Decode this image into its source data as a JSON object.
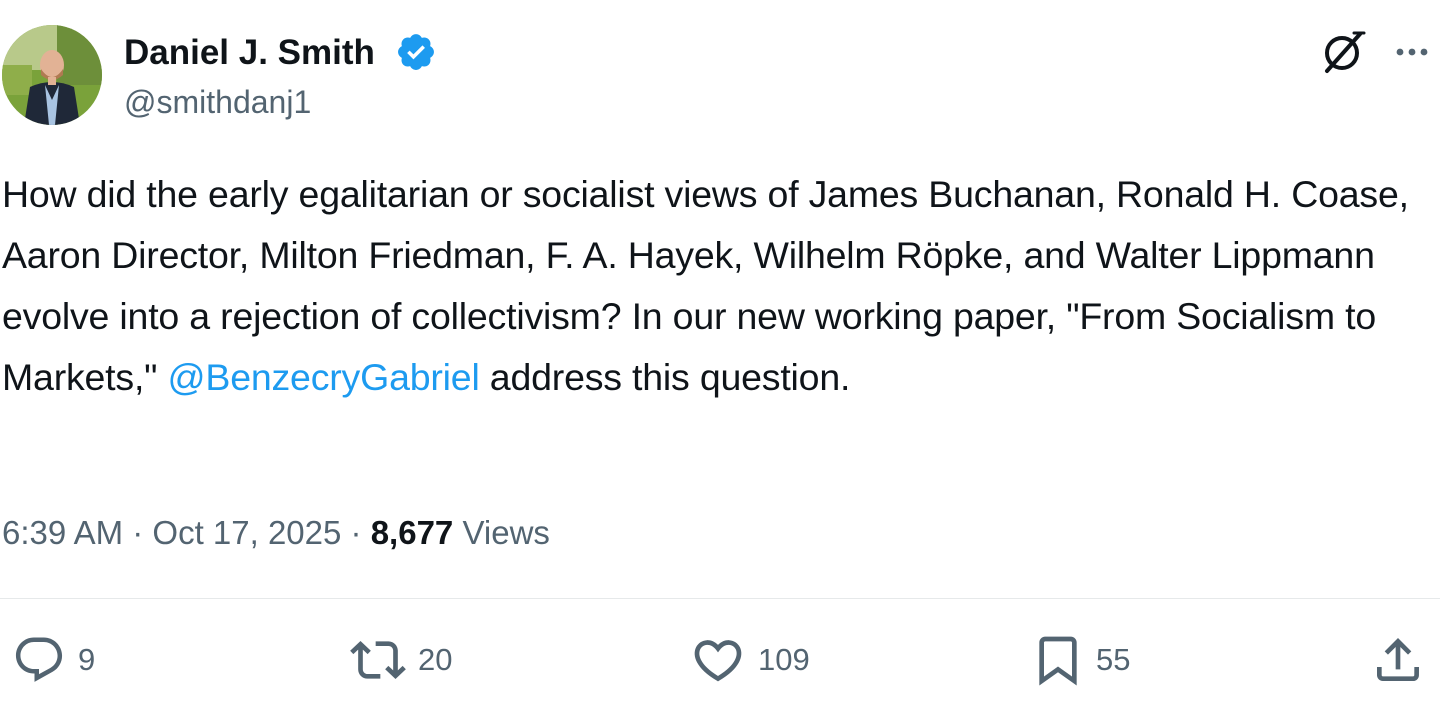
{
  "author": {
    "display_name": "Daniel J. Smith",
    "handle": "@smithdanj1",
    "verified": true
  },
  "tweet": {
    "text_before_mention": "How did the early egalitarian or socialist views of James Buchanan, Ronald H. Coase, Aaron Director, Milton Friedman, F. A. Hayek, Wilhelm Röpke, and Walter Lippmann evolve into a rejection of collectivism? In our new working paper, \"From Socialism to Markets,\" ",
    "mention": "@BenzecryGabriel",
    "text_after_mention": " address this question."
  },
  "meta": {
    "time": "6:39 AM",
    "separator1": " · ",
    "date": "Oct 17, 2025",
    "separator2": " · ",
    "views_count": "8,677",
    "views_label": " Views"
  },
  "actions": {
    "reply_count": "9",
    "retweet_count": "20",
    "like_count": "109",
    "bookmark_count": "55"
  },
  "icons": {
    "verified": "verified-badge-icon",
    "grok": "grok-icon",
    "more": "more-icon",
    "reply": "reply-icon",
    "retweet": "retweet-icon",
    "like": "heart-icon",
    "bookmark": "bookmark-icon",
    "share": "share-icon"
  },
  "colors": {
    "text_primary": "#0f1419",
    "text_secondary": "#536471",
    "accent": "#1d9bf0",
    "divider": "#e6e9ea"
  }
}
